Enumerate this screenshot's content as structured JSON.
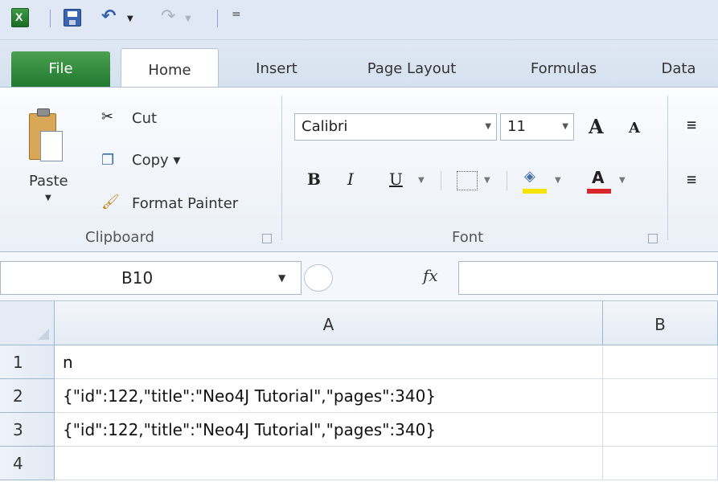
{
  "qat": {
    "customize_glyph": "="
  },
  "tabs": {
    "file": "File",
    "home": "Home",
    "insert": "Insert",
    "page_layout": "Page Layout",
    "formulas": "Formulas",
    "data": "Data"
  },
  "clipboard": {
    "paste": "Paste",
    "cut": "Cut",
    "copy": "Copy ▾",
    "format_painter": "Format Painter",
    "group_label": "Clipboard"
  },
  "font": {
    "name": "Calibri",
    "size": "11",
    "grow": "A",
    "shrink": "A",
    "bold": "B",
    "italic": "I",
    "underline": "U",
    "font_color_letter": "A",
    "group_label": "Font",
    "fill_color": "#f5e400",
    "font_color": "#d8262c"
  },
  "formula_bar": {
    "name_box": "B10",
    "fx": "fx",
    "formula_value": ""
  },
  "sheet": {
    "columns": [
      "A",
      "B"
    ],
    "rows": [
      {
        "num": "1",
        "a": "n",
        "b": ""
      },
      {
        "num": "2",
        "a": "{\"id\":122,\"title\":\"Neo4J Tutorial\",\"pages\":340}",
        "b": ""
      },
      {
        "num": "3",
        "a": "{\"id\":122,\"title\":\"Neo4J Tutorial\",\"pages\":340}",
        "b": ""
      },
      {
        "num": "4",
        "a": "",
        "b": ""
      }
    ]
  }
}
